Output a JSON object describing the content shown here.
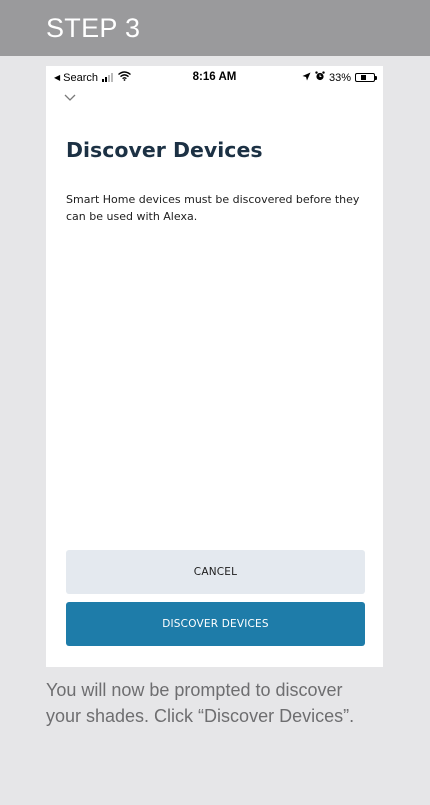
{
  "header": {
    "step_label": "STEP 3"
  },
  "status_bar": {
    "back_label": "Search",
    "time": "8:16 AM",
    "battery": "33%",
    "battery_level": 0.33
  },
  "screen": {
    "title": "Discover Devices",
    "description": "Smart Home devices must be discovered before they can be used with Alexa.",
    "cancel_label": "CANCEL",
    "discover_label": "DISCOVER DEVICES"
  },
  "caption": "You will now be prompted to discover your shades. Click “Discover Devices”.",
  "colors": {
    "header_bg": "#9a9a9c",
    "title": "#1c3144",
    "primary_button": "#1e7ca9",
    "secondary_button": "#e4e9ef",
    "caption_text": "#6e6e70"
  },
  "icons": [
    "back-triangle-icon",
    "signal-icon",
    "wifi-icon",
    "location-arrow-icon",
    "alarm-icon",
    "battery-icon",
    "chevron-down-icon"
  ]
}
